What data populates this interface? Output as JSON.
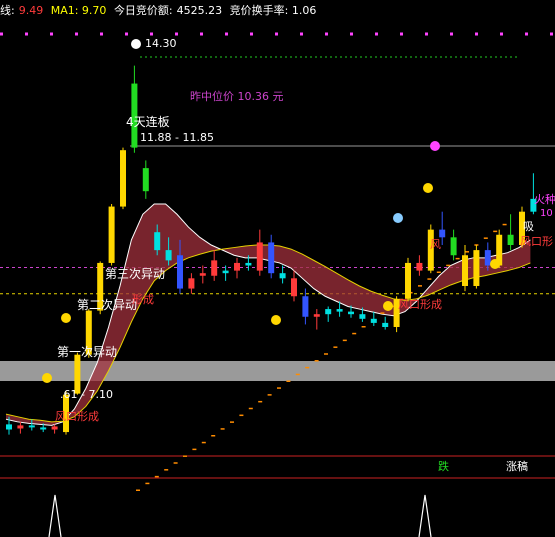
{
  "header": {
    "item1_label": "线:",
    "item1_value": "9.49",
    "item2": "MA1: 9.70",
    "item3_label": "今日竞价额:",
    "item3_value": "4525.23",
    "item4": "竞价换手率: 1.06",
    "colors": {
      "label": "#ffffff",
      "value": "#ff3b3b",
      "ma": "#ffff00"
    }
  },
  "annotations": {
    "high_price": "14.30",
    "midline_price": "昨中位价  10.36 元",
    "streak": "4天连板",
    "range_top": "11.88 - 11.85",
    "third_move": "第三次异动",
    "second_move_overlap": "第二次异动",
    "first_move": "第一次异动",
    "range_bottom": ".61 - 7.10",
    "wind_bottom": "风口形成",
    "wind_mid": "风口形成",
    "wind_mid_upper": "形成",
    "wind_right_a": "风",
    "wind_right_b": "风口形",
    "fire_right": "火种",
    "xi_right": "吸",
    "num_right": "10",
    "fall_label": "跌",
    "limit_label": "涨稿"
  },
  "chart_data": {
    "type": "candlestick",
    "title": "",
    "ylim": [
      6.8,
      14.8
    ],
    "reference_lines": [
      {
        "name": "昨中位价",
        "value": 10.36,
        "color": "#cc44cc"
      },
      {
        "name": "",
        "value": 9.85,
        "color": "#e6d200"
      }
    ],
    "candles": [
      {
        "o": 7.3,
        "h": 7.45,
        "l": 7.1,
        "c": 7.2,
        "color": "#00e0e0"
      },
      {
        "o": 7.22,
        "h": 7.35,
        "l": 7.12,
        "c": 7.28,
        "color": "#ff3b3b"
      },
      {
        "o": 7.28,
        "h": 7.4,
        "l": 7.18,
        "c": 7.25,
        "color": "#00e0e0"
      },
      {
        "o": 7.24,
        "h": 7.32,
        "l": 7.15,
        "c": 7.2,
        "color": "#00e0e0"
      },
      {
        "o": 7.2,
        "h": 7.3,
        "l": 7.12,
        "c": 7.26,
        "color": "#ff3b3b"
      },
      {
        "o": 7.15,
        "h": 7.95,
        "l": 7.1,
        "c": 7.88,
        "color": "#ffd700"
      },
      {
        "o": 7.9,
        "h": 8.7,
        "l": 7.88,
        "c": 8.66,
        "color": "#ffd700"
      },
      {
        "o": 8.66,
        "h": 9.55,
        "l": 8.6,
        "c": 9.52,
        "color": "#ffd700"
      },
      {
        "o": 9.52,
        "h": 10.48,
        "l": 9.45,
        "c": 10.45,
        "color": "#ffd700"
      },
      {
        "o": 10.45,
        "h": 11.6,
        "l": 10.4,
        "c": 11.55,
        "color": "#ffd700"
      },
      {
        "o": 11.55,
        "h": 12.7,
        "l": 11.5,
        "c": 12.65,
        "color": "#ffd700"
      },
      {
        "o": 12.7,
        "h": 14.3,
        "l": 12.6,
        "c": 13.95,
        "color": "#22dd22"
      },
      {
        "o": 12.3,
        "h": 12.45,
        "l": 11.7,
        "c": 11.85,
        "color": "#22dd22"
      },
      {
        "o": 11.05,
        "h": 11.2,
        "l": 10.6,
        "c": 10.7,
        "color": "#00e0e0"
      },
      {
        "o": 10.7,
        "h": 10.95,
        "l": 10.4,
        "c": 10.5,
        "color": "#00e0e0"
      },
      {
        "o": 10.6,
        "h": 10.9,
        "l": 9.85,
        "c": 9.95,
        "color": "#3355ff"
      },
      {
        "o": 9.95,
        "h": 10.25,
        "l": 9.85,
        "c": 10.15,
        "color": "#ff3b3b"
      },
      {
        "o": 10.2,
        "h": 10.4,
        "l": 10.05,
        "c": 10.25,
        "color": "#ff3b3b"
      },
      {
        "o": 10.5,
        "h": 10.7,
        "l": 10.1,
        "c": 10.2,
        "color": "#ff3b3b"
      },
      {
        "o": 10.25,
        "h": 10.4,
        "l": 10.1,
        "c": 10.3,
        "color": "#00e0e0"
      },
      {
        "o": 10.3,
        "h": 10.55,
        "l": 10.15,
        "c": 10.45,
        "color": "#ff3b3b"
      },
      {
        "o": 10.45,
        "h": 10.6,
        "l": 10.3,
        "c": 10.4,
        "color": "#00e0e0"
      },
      {
        "o": 10.3,
        "h": 11.1,
        "l": 10.2,
        "c": 10.85,
        "color": "#ff3b3b"
      },
      {
        "o": 10.85,
        "h": 11.0,
        "l": 10.15,
        "c": 10.25,
        "color": "#3355ff"
      },
      {
        "o": 10.25,
        "h": 10.4,
        "l": 10.05,
        "c": 10.15,
        "color": "#00e0e0"
      },
      {
        "o": 10.15,
        "h": 10.3,
        "l": 9.7,
        "c": 9.8,
        "color": "#ff3b3b"
      },
      {
        "o": 9.8,
        "h": 9.95,
        "l": 9.25,
        "c": 9.4,
        "color": "#3355ff"
      },
      {
        "o": 9.4,
        "h": 9.55,
        "l": 9.15,
        "c": 9.45,
        "color": "#ff3b3b"
      },
      {
        "o": 9.45,
        "h": 9.6,
        "l": 9.3,
        "c": 9.55,
        "color": "#00e0e0"
      },
      {
        "o": 9.55,
        "h": 9.7,
        "l": 9.4,
        "c": 9.5,
        "color": "#00e0e0"
      },
      {
        "o": 9.5,
        "h": 9.62,
        "l": 9.38,
        "c": 9.45,
        "color": "#00e0e0"
      },
      {
        "o": 9.45,
        "h": 9.58,
        "l": 9.3,
        "c": 9.36,
        "color": "#00e0e0"
      },
      {
        "o": 9.36,
        "h": 9.5,
        "l": 9.22,
        "c": 9.28,
        "color": "#00e0e0"
      },
      {
        "o": 9.28,
        "h": 9.4,
        "l": 9.15,
        "c": 9.2,
        "color": "#00e0e0"
      },
      {
        "o": 9.2,
        "h": 9.8,
        "l": 9.1,
        "c": 9.75,
        "color": "#ffd700"
      },
      {
        "o": 9.75,
        "h": 10.55,
        "l": 9.7,
        "c": 10.45,
        "color": "#ffd700"
      },
      {
        "o": 10.45,
        "h": 10.6,
        "l": 10.2,
        "c": 10.3,
        "color": "#ff3b3b"
      },
      {
        "o": 10.3,
        "h": 11.2,
        "l": 10.25,
        "c": 11.1,
        "color": "#ffd700"
      },
      {
        "o": 11.1,
        "h": 11.45,
        "l": 10.8,
        "c": 10.95,
        "color": "#3355ff"
      },
      {
        "o": 10.95,
        "h": 11.1,
        "l": 10.5,
        "c": 10.6,
        "color": "#22dd22"
      },
      {
        "o": 10.6,
        "h": 10.8,
        "l": 9.9,
        "c": 10.0,
        "color": "#ffd700"
      },
      {
        "o": 10.0,
        "h": 10.8,
        "l": 9.95,
        "c": 10.7,
        "color": "#ffd700"
      },
      {
        "o": 10.7,
        "h": 10.85,
        "l": 10.3,
        "c": 10.4,
        "color": "#3355ff"
      },
      {
        "o": 10.4,
        "h": 11.1,
        "l": 10.35,
        "c": 11.0,
        "color": "#ffd700"
      },
      {
        "o": 11.0,
        "h": 11.4,
        "l": 10.7,
        "c": 10.8,
        "color": "#22dd22"
      },
      {
        "o": 10.8,
        "h": 11.55,
        "l": 10.75,
        "c": 11.45,
        "color": "#ffd700"
      },
      {
        "o": 11.45,
        "h": 12.2,
        "l": 11.4,
        "c": 11.7,
        "color": "#00e0e0"
      }
    ],
    "moving_averages": [
      {
        "values": [
          7.4,
          7.35,
          7.32,
          7.3,
          7.28,
          7.35,
          7.6,
          8.0,
          8.5,
          9.2,
          10.0,
          10.9,
          11.4,
          11.6,
          11.6,
          11.4,
          11.15,
          10.95,
          10.8,
          10.7,
          10.6,
          10.55,
          10.55,
          10.5,
          10.45,
          10.35,
          10.15,
          9.95,
          9.8,
          9.7,
          9.6,
          9.55,
          9.5,
          9.45,
          9.42,
          9.5,
          9.7,
          9.95,
          10.2,
          10.4,
          10.5,
          10.55,
          10.55,
          10.6,
          10.65,
          10.75,
          10.9
        ],
        "color": "#ffffff"
      },
      {
        "values": [
          7.5,
          7.45,
          7.4,
          7.38,
          7.35,
          7.36,
          7.45,
          7.65,
          7.95,
          8.35,
          8.8,
          9.3,
          9.75,
          10.1,
          10.3,
          10.45,
          10.55,
          10.62,
          10.68,
          10.72,
          10.75,
          10.78,
          10.8,
          10.8,
          10.78,
          10.72,
          10.62,
          10.5,
          10.38,
          10.25,
          10.12,
          10.0,
          9.9,
          9.82,
          9.75,
          9.72,
          9.75,
          9.82,
          9.92,
          10.02,
          10.1,
          10.16,
          10.2,
          10.25,
          10.3,
          10.36,
          10.45
        ],
        "color": "#e6d200"
      }
    ],
    "indicators": {
      "spikes": [
        {
          "index": 2,
          "color": "#ffffff"
        },
        {
          "index": 40,
          "color": "#ffffff"
        }
      ]
    }
  }
}
